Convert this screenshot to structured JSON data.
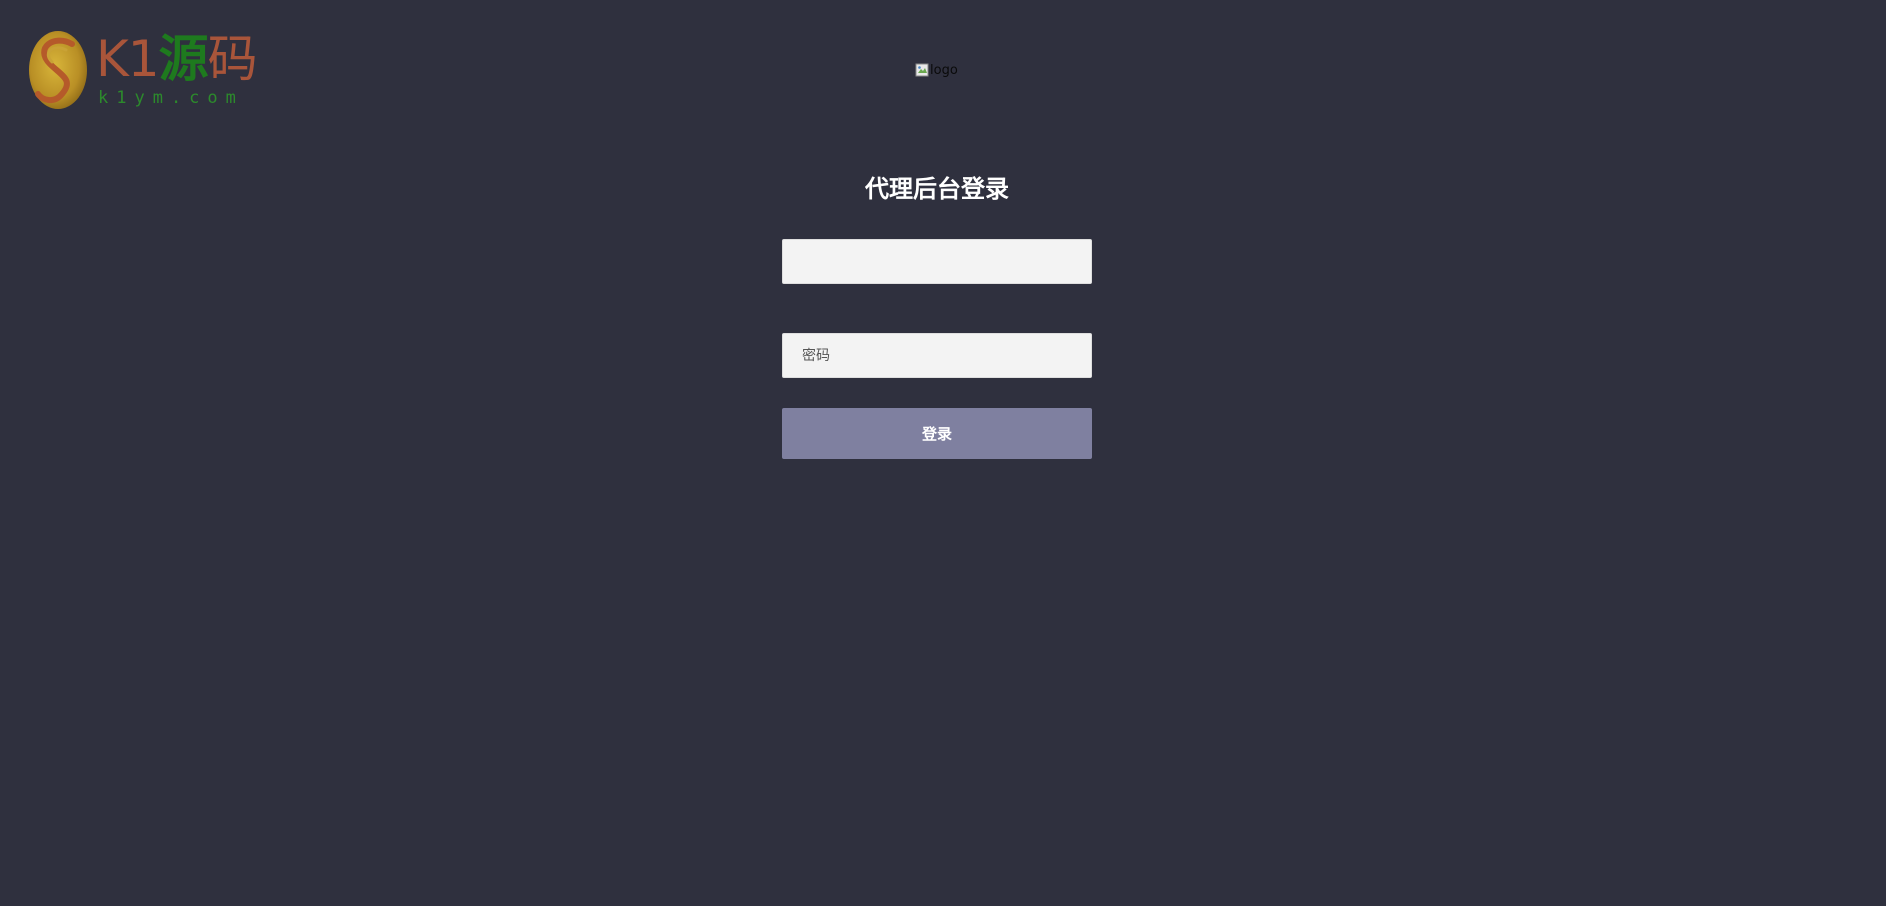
{
  "watermark": {
    "brand_k1": "K1",
    "brand_c1": "源",
    "brand_c2": "码",
    "url": "k1ym.com"
  },
  "logo": {
    "alt": "logo"
  },
  "login": {
    "title": "代理后台登录",
    "username_value": "",
    "username_placeholder": "",
    "password_placeholder": "密码",
    "submit_label": "登录"
  },
  "colors": {
    "background": "#2f303e",
    "button": "#7f80a0",
    "input_bg": "#f3f3f3"
  }
}
